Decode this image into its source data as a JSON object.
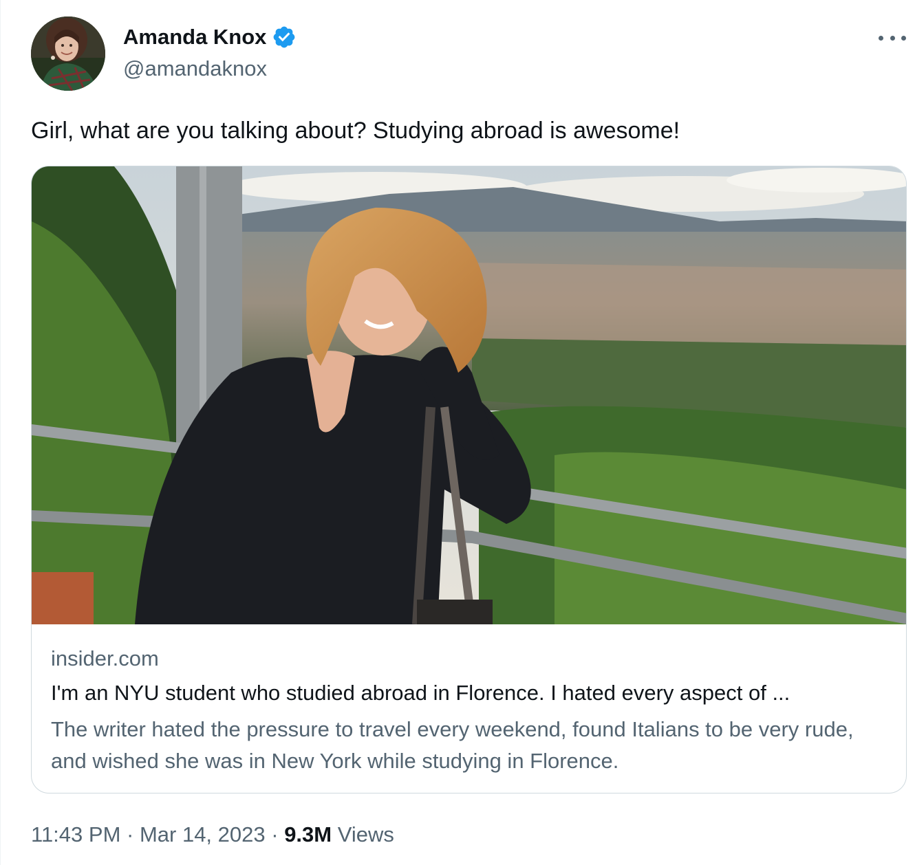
{
  "author": {
    "name": "Amanda Knox",
    "handle": "@amandaknox",
    "verified": true,
    "avatar_icon": "profile-photo"
  },
  "tweet": {
    "text": "Girl, what are you talking about? Studying abroad is awesome!"
  },
  "card": {
    "image_description_icon": "woman-overlooking-florence-photo",
    "domain": "insider.com",
    "title": "I'm an NYU student who studied abroad in Florence. I hated every aspect of ...",
    "description": "The writer hated the pressure to travel every weekend, found Italians to be very rude, and wished she was in New York while studying in Florence."
  },
  "meta": {
    "time": "11:43 PM",
    "separator": " · ",
    "date": "Mar 14, 2023",
    "views_count": "9.3M",
    "views_label": " Views"
  },
  "colors": {
    "text_primary": "#0f1419",
    "text_secondary": "#536471",
    "verified_blue": "#1d9bf0",
    "border": "#cfd9de"
  },
  "icons": {
    "more": "more-horizontal-icon",
    "verified": "verified-badge-icon"
  }
}
